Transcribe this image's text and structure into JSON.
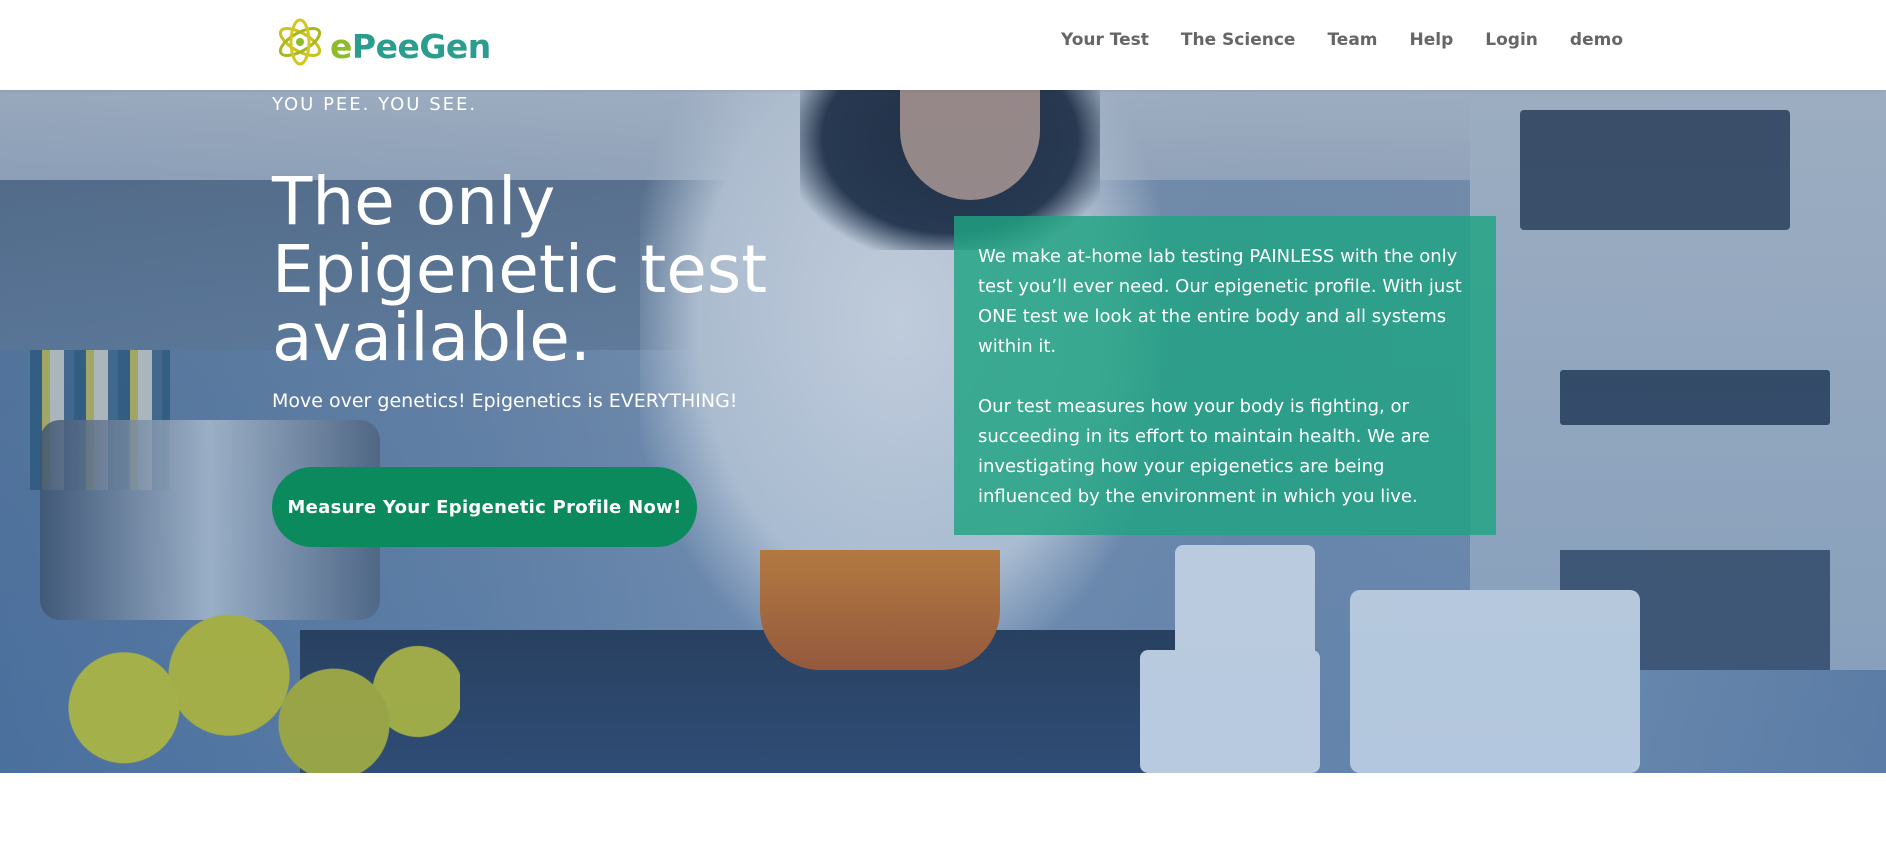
{
  "brand": {
    "logo_text_e": "e",
    "logo_text_rest": "PeeGen",
    "colors": {
      "logo_green": "#8dbb2a",
      "logo_teal": "#2a9d8f",
      "cta": "#0b8a5e",
      "info_box": "#20a482"
    }
  },
  "nav": {
    "items": [
      {
        "label": "Your Test"
      },
      {
        "label": "The Science"
      },
      {
        "label": "Team"
      },
      {
        "label": "Help"
      },
      {
        "label": "Login"
      },
      {
        "label": "demo"
      }
    ]
  },
  "hero": {
    "tagline": "YOU PEE. YOU SEE.",
    "headline": "The only Epigenetic test available.",
    "subhead": "Move over genetics! Epigenetics is EVERYTHING!",
    "cta_label": "Measure Your Epigenetic Profile Now!",
    "info": {
      "paragraph1": "We make at-home lab testing PAINLESS with the only test you’ll ever need. Our epigenetic profile. With just ONE test we look at the entire body and all systems within it.",
      "paragraph2": "Our test measures how your body is fighting, or succeeding in its effort to maintain health. We are investigating how your epigenetics are being influenced by the environment in which you live."
    }
  }
}
